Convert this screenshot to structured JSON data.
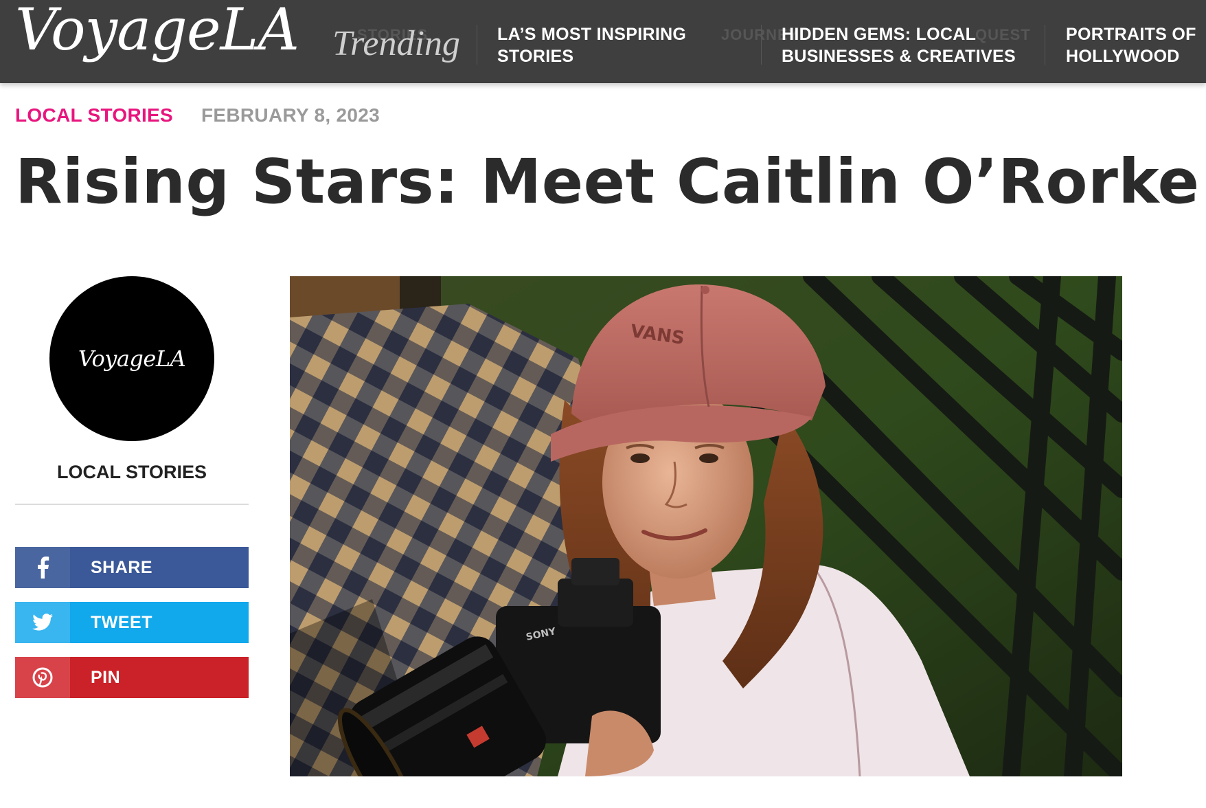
{
  "header": {
    "logo": "VoyageLA",
    "trending_label": "Trending",
    "trending_links": [
      "LA’S MOST INSPIRING STORIES",
      "HIDDEN GEMS: LOCAL BUSINESSES & CREATIVES",
      "PORTRAITS OF HOLLYWOOD"
    ]
  },
  "article": {
    "category": "LOCAL STORIES",
    "date": "FEBRUARY 8, 2023",
    "title": "Rising Stars: Meet Caitlin O’Rorke"
  },
  "sidebar": {
    "author_avatar_text": "VoyageLA",
    "author_name": "LOCAL STORIES",
    "share_buttons": [
      {
        "label": "SHARE",
        "icon": "facebook-icon",
        "icon_bg": "#4a66a0",
        "label_bg": "#3b5998"
      },
      {
        "label": "TWEET",
        "icon": "twitter-icon",
        "icon_bg": "#39b5f0",
        "label_bg": "#11a8ec"
      },
      {
        "label": "PIN",
        "icon": "pinterest-icon",
        "icon_bg": "#d8434a",
        "label_bg": "#cb2128"
      }
    ]
  },
  "hero_image": {
    "cap_text": "VANS",
    "camera_text": "SONY"
  },
  "colors": {
    "topbar_bg": "#3f3f3f",
    "category": "#e8157e",
    "date": "#9a9a9a",
    "title": "#2b2b2b"
  }
}
